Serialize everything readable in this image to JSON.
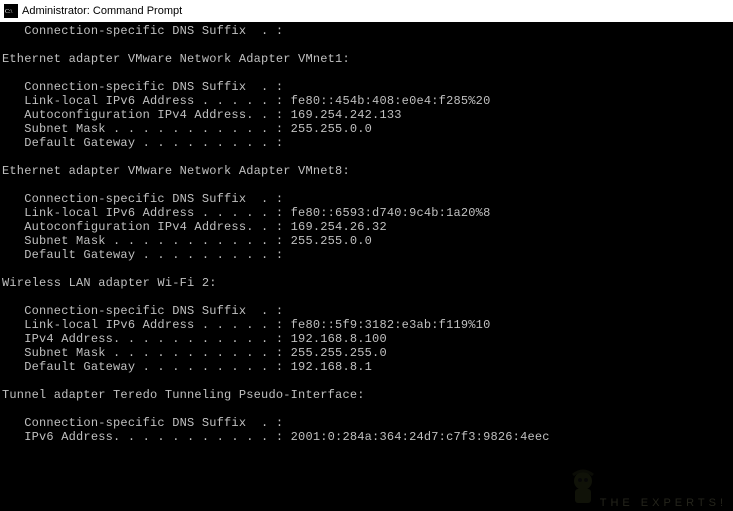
{
  "titlebar": {
    "icon_glyph": "C:\\",
    "text": "Administrator: Command Prompt"
  },
  "top": {
    "dns_line": "   Connection-specific DNS Suffix  . :"
  },
  "adapters": [
    {
      "header": "Ethernet adapter VMware Network Adapter VMnet1:",
      "lines": [
        "   Connection-specific DNS Suffix  . :",
        "   Link-local IPv6 Address . . . . . : fe80::454b:408:e0e4:f285%20",
        "   Autoconfiguration IPv4 Address. . : 169.254.242.133",
        "   Subnet Mask . . . . . . . . . . . : 255.255.0.0",
        "   Default Gateway . . . . . . . . . :"
      ]
    },
    {
      "header": "Ethernet adapter VMware Network Adapter VMnet8:",
      "lines": [
        "   Connection-specific DNS Suffix  . :",
        "   Link-local IPv6 Address . . . . . : fe80::6593:d740:9c4b:1a20%8",
        "   Autoconfiguration IPv4 Address. . : 169.254.26.32",
        "   Subnet Mask . . . . . . . . . . . : 255.255.0.0",
        "   Default Gateway . . . . . . . . . :"
      ]
    },
    {
      "header": "Wireless LAN adapter Wi-Fi 2:",
      "lines": [
        "   Connection-specific DNS Suffix  . :",
        "   Link-local IPv6 Address . . . . . : fe80::5f9:3182:e3ab:f119%10",
        "   IPv4 Address. . . . . . . . . . . : 192.168.8.100",
        "   Subnet Mask . . . . . . . . . . . : 255.255.255.0",
        "   Default Gateway . . . . . . . . . : 192.168.8.1"
      ]
    },
    {
      "header": "Tunnel adapter Teredo Tunneling Pseudo-Interface:",
      "lines": [
        "   Connection-specific DNS Suffix  . :",
        "   IPv6 Address. . . . . . . . . . . : 2001:0:284a:364:24d7:c7f3:9826:4eec"
      ]
    }
  ],
  "watermark": {
    "text": "THE EXPERTS!"
  }
}
